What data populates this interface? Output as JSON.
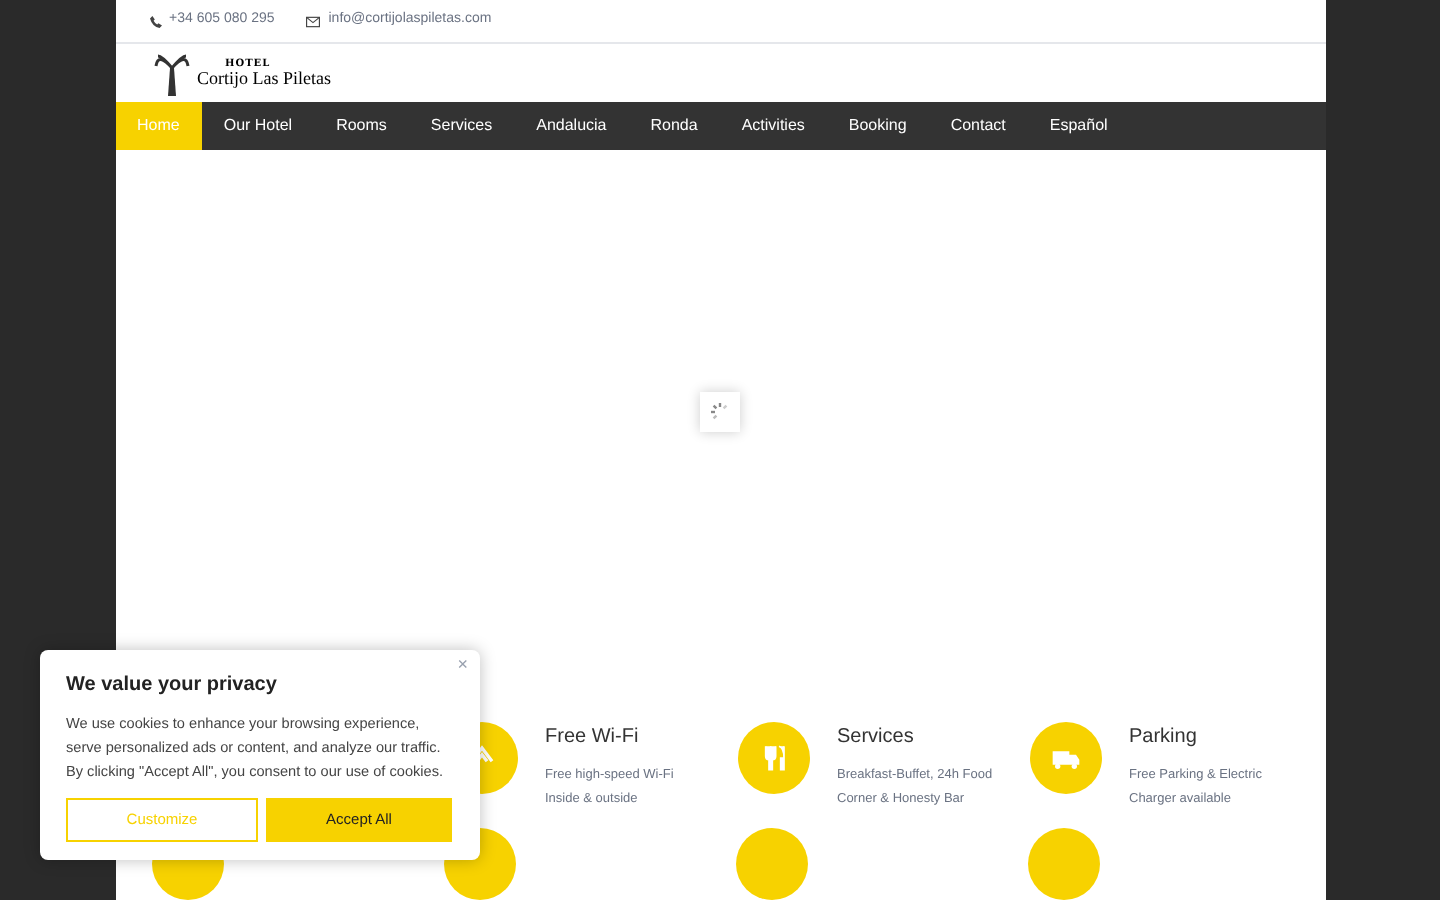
{
  "topbar": {
    "phone": "+34 605 080 295",
    "email": "info@cortijolaspiletas.com"
  },
  "logo": {
    "small": "HOTEL",
    "name": "Cortijo Las Piletas"
  },
  "nav": [
    {
      "label": "Home",
      "selected": true
    },
    {
      "label": "Our Hotel",
      "selected": false
    },
    {
      "label": "Rooms",
      "selected": false
    },
    {
      "label": "Services",
      "selected": false
    },
    {
      "label": "Andalucia",
      "selected": false
    },
    {
      "label": "Ronda",
      "selected": false
    },
    {
      "label": "Activities",
      "selected": false
    },
    {
      "label": "Booking",
      "selected": false
    },
    {
      "label": "Contact",
      "selected": false
    },
    {
      "label": "Español",
      "selected": false
    }
  ],
  "features": [
    {
      "kind": "wifi",
      "title": "Free Wi-Fi",
      "lines": [
        "Free high-speed Wi-Fi",
        "Inside & outside"
      ]
    },
    {
      "kind": "food",
      "title": "Services",
      "lines": [
        "Breakfast-Buffet, 24h Food",
        "Corner & Honesty Bar"
      ]
    },
    {
      "kind": "truck",
      "title": "Parking",
      "lines": [
        "Free Parking & Electric",
        "Charger available"
      ]
    }
  ],
  "cookie": {
    "title": "We value your privacy",
    "text": "We use cookies to enhance your browsing experience, serve personalized ads or content, and analyze our traffic. By clicking \"Accept All\", you consent to our use of cookies.",
    "close": "×",
    "buttons": [
      "Customize",
      "Accept All"
    ]
  }
}
